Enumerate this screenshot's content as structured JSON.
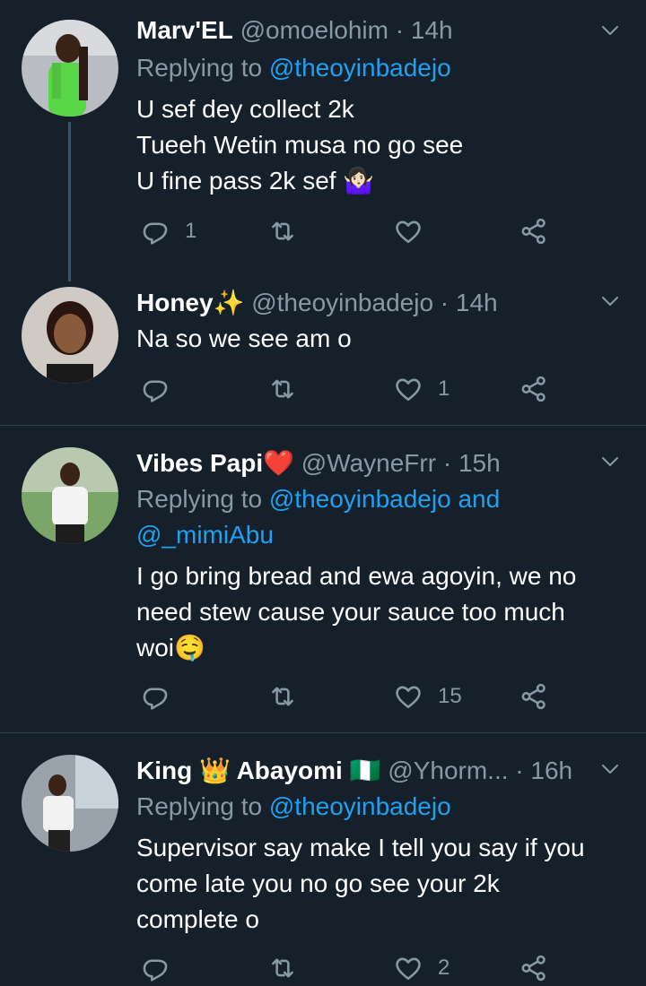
{
  "tweets": [
    {
      "name": "Marv'EL",
      "handle": "@omoelohim",
      "sep": "·",
      "time": "14h",
      "replying_prefix": "Replying to ",
      "replying_mention": "@theoyinbadejo",
      "replying_suffix": "",
      "body": [
        "U sef dey collect 2k",
        "Tueeh Wetin musa no go see",
        "U fine pass 2k sef 🤷🏻‍♀️"
      ],
      "reply_count": "1",
      "retweet_count": "",
      "like_count": ""
    },
    {
      "name": "Honey✨",
      "handle": "@theoyinbadejo",
      "sep": "·",
      "time": "14h",
      "body": [
        "Na so we see am o"
      ],
      "reply_count": "",
      "retweet_count": "",
      "like_count": "1"
    },
    {
      "name": "Vibes Papi❤️",
      "handle": "@WayneFrr",
      "sep": "·",
      "time": "15h",
      "replying_prefix": "Replying to ",
      "replying_mention": "@theoyinbadejo and",
      "replying_mention2": "@_mimiAbu",
      "body": [
        "I go bring bread and ewa agoyin, we no",
        "need stew cause your sauce too much",
        "woi🤤"
      ],
      "reply_count": "",
      "retweet_count": "",
      "like_count": "15"
    },
    {
      "name": "King 👑 Abayomi 🇳🇬",
      "handle": "@Yhorm...",
      "sep": "·",
      "time": "16h",
      "replying_prefix": "Replying to ",
      "replying_mention": "@theoyinbadejo",
      "body": [
        "Supervisor say make I tell you say if you",
        "come late you no go see your 2k",
        "complete o"
      ],
      "reply_count": "",
      "retweet_count": "",
      "like_count": "2"
    }
  ],
  "colors": {
    "background": "#15202b",
    "secondary_text": "#8899a6",
    "link": "#1da1f2",
    "divider": "#38444d"
  }
}
